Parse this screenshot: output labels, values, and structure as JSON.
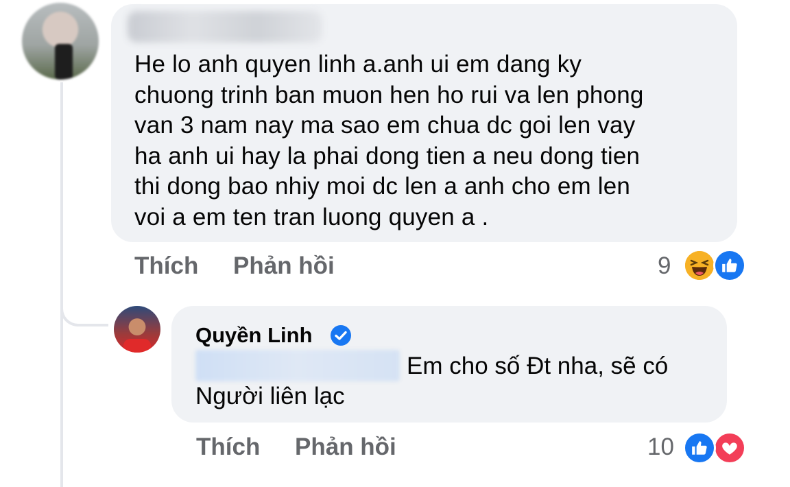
{
  "comment": {
    "text": "He lo anh quyen linh a.anh ui em dang ky\nchuong trinh ban muon hen ho rui va len phong\nvan 3 nam nay ma sao em chua dc goi len vay\nha anh ui hay la phai dong tien a neu dong tien\nthi dong bao nhiy moi dc len a anh cho em len\nvoi a em ten tran luong quyen a .",
    "like_label": "Thích",
    "reply_label": "Phản hồi",
    "reaction_count": "9",
    "reactions": [
      "haha-icon",
      "like-icon"
    ]
  },
  "reply": {
    "author": "Quyền Linh",
    "verified": true,
    "text_line1": "Em cho số Đt nha, sẽ có",
    "text_line2": "Người liên lạc",
    "like_label": "Thích",
    "reply_label": "Phản hồi",
    "reaction_count": "10",
    "reactions": [
      "like-icon",
      "love-icon"
    ]
  },
  "colors": {
    "bubble": "#f0f2f5",
    "secondary_text": "#65676b",
    "like_blue": "#1877f2",
    "love_red": "#f33e58",
    "haha_yellow": "#f7b125"
  }
}
